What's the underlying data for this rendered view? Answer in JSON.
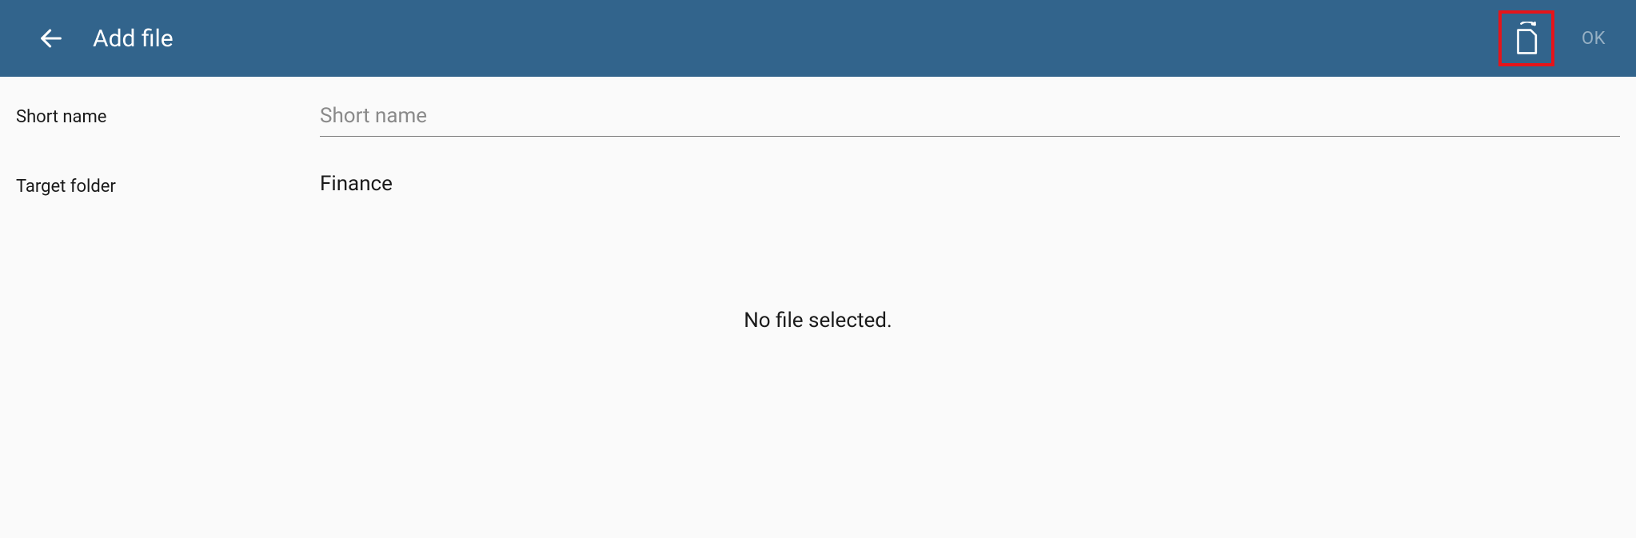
{
  "header": {
    "title": "Add file",
    "ok_label": "OK"
  },
  "form": {
    "short_name_label": "Short name",
    "short_name_placeholder": "Short name",
    "short_name_value": "",
    "target_folder_label": "Target folder",
    "target_folder_value": "Finance"
  },
  "empty_message": "No file selected."
}
